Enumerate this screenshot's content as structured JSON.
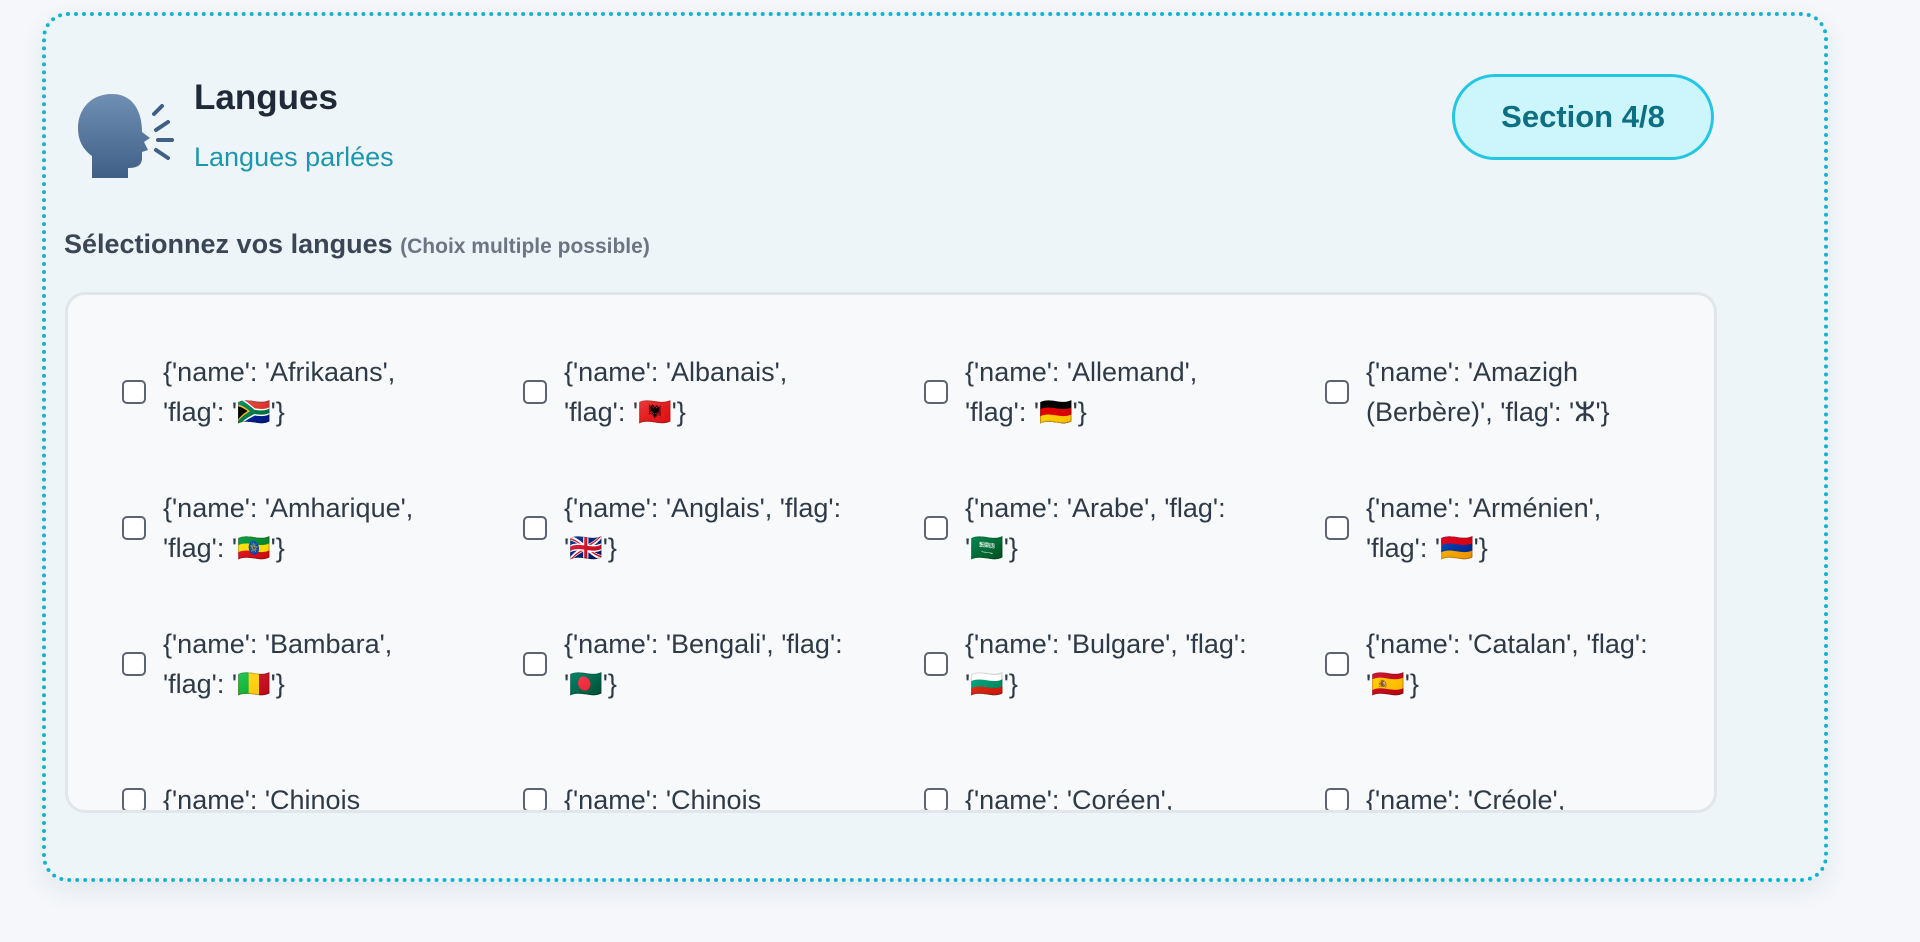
{
  "header": {
    "icon": "speaking-head-icon",
    "title": "Langues",
    "subtitle": "Langues parlées",
    "section_badge": "Section 4/8"
  },
  "prompt": {
    "label": "Sélectionnez vos langues",
    "hint": "(Choix multiple possible)"
  },
  "colors": {
    "accent": "#17b2cf",
    "badge_bg": "#cdf6fc",
    "badge_text": "#0e6f83",
    "subtitle": "#1d97ad"
  },
  "options": [
    {
      "label": "{'name': 'Afrikaans', 'flag': '🇿🇦'}",
      "checked": false
    },
    {
      "label": "{'name': 'Albanais', 'flag': '🇦🇱'}",
      "checked": false
    },
    {
      "label": "{'name': 'Allemand', 'flag': '🇩🇪'}",
      "checked": false
    },
    {
      "label": "{'name': 'Amazigh (Berbère)', 'flag': 'ⵣ'}",
      "checked": false
    },
    {
      "label": "{'name': 'Amharique', 'flag': '🇪🇹'}",
      "checked": false
    },
    {
      "label": "{'name': 'Anglais', 'flag': '🇬🇧'}",
      "checked": false
    },
    {
      "label": "{'name': 'Arabe', 'flag': '🇸🇦'}",
      "checked": false
    },
    {
      "label": "{'name': 'Arménien', 'flag': '🇦🇲'}",
      "checked": false
    },
    {
      "label": "{'name': 'Bambara', 'flag': '🇲🇱'}",
      "checked": false
    },
    {
      "label": "{'name': 'Bengali', 'flag': '🇧🇩'}",
      "checked": false
    },
    {
      "label": "{'name': 'Bulgare', 'flag': '🇧🇬'}",
      "checked": false
    },
    {
      "label": "{'name': 'Catalan', 'flag': '🇪🇸'}",
      "checked": false
    },
    {
      "label": "{'name': 'Chinois",
      "checked": false
    },
    {
      "label": "{'name': 'Chinois",
      "checked": false
    },
    {
      "label": "{'name': 'Coréen',",
      "checked": false
    },
    {
      "label": "{'name': 'Créole',",
      "checked": false
    }
  ]
}
